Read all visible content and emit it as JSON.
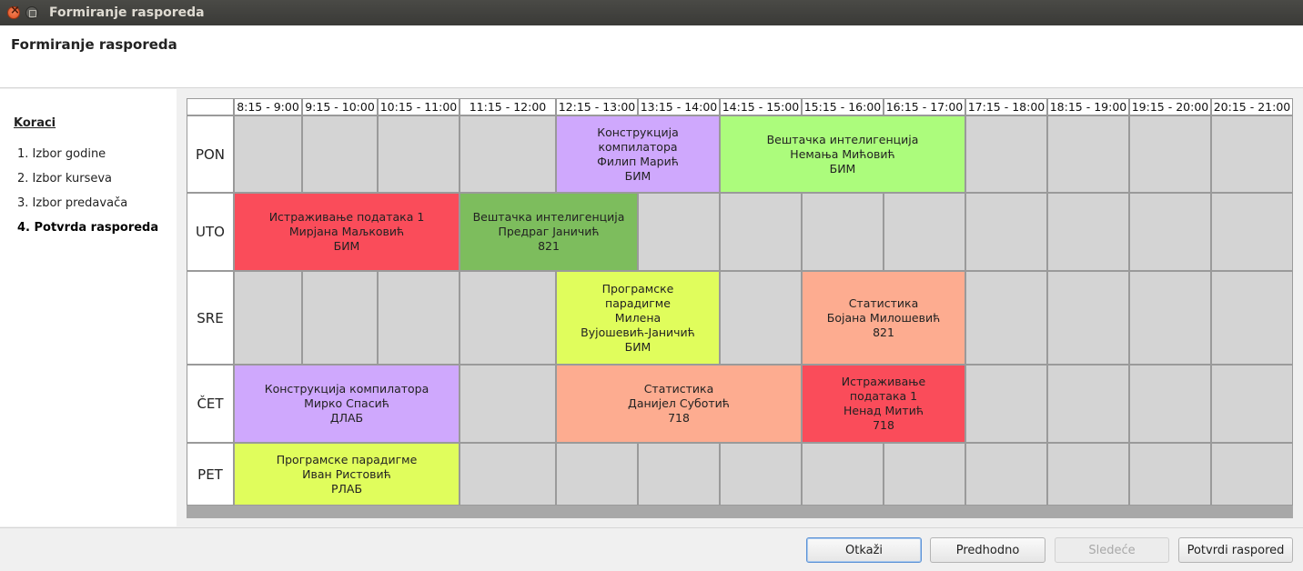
{
  "window": {
    "title": "Formiranje rasporeda"
  },
  "header": {
    "title": "Formiranje rasporeda"
  },
  "steps": {
    "title": "Koraci",
    "items": [
      {
        "label": "1. Izbor godine",
        "active": false
      },
      {
        "label": "2. Izbor kurseva",
        "active": false
      },
      {
        "label": "3. Izbor predavača",
        "active": false
      },
      {
        "label": "4. Potvrda rasporeda",
        "active": true
      }
    ]
  },
  "schedule": {
    "time_slots": [
      "8:15 - 9:00",
      "9:15 - 10:00",
      "10:15 - 11:00",
      "11:15 - 12:00",
      "12:15 - 13:00",
      "13:15 - 14:00",
      "14:15 - 15:00",
      "15:15 - 16:00",
      "16:15 - 17:00",
      "17:15 - 18:00",
      "18:15 - 19:00",
      "19:15 - 20:00",
      "20:15 - 21:00"
    ],
    "days": [
      "PON",
      "UTO",
      "SRE",
      "ČET",
      "PET"
    ],
    "classes": [
      {
        "day": 0,
        "start": 4,
        "span": 2,
        "color": "#cfa8fd",
        "lines": [
          "Конструкција",
          "компилатора",
          "Филип Марић",
          "БИМ"
        ]
      },
      {
        "day": 0,
        "start": 6,
        "span": 3,
        "color": "#acfc7c",
        "lines": [
          "Вештачка интелигенција",
          "Немања Мићовић",
          "БИМ"
        ]
      },
      {
        "day": 1,
        "start": 0,
        "span": 3,
        "color": "#fa4c5a",
        "lines": [
          "Истраживање података 1",
          "Мирјана Маљковић",
          "БИМ"
        ]
      },
      {
        "day": 1,
        "start": 3,
        "span": 2,
        "color": "#7dbd5d",
        "lines": [
          "Вештачка интелигенција",
          "Предраг Јаничић",
          "821"
        ]
      },
      {
        "day": 2,
        "start": 4,
        "span": 2,
        "color": "#e0fd5c",
        "lines": [
          "Програмске",
          "парадигме",
          "Милена",
          "Вујошевић-Јаничић",
          "БИМ"
        ]
      },
      {
        "day": 2,
        "start": 7,
        "span": 2,
        "color": "#fdac90",
        "lines": [
          "Статистика",
          "Бојана Милошевић",
          "821"
        ]
      },
      {
        "day": 3,
        "start": 0,
        "span": 3,
        "color": "#cfa8fd",
        "lines": [
          "Конструкција компилатора",
          "Мирко Спасић",
          "ДЛАБ"
        ]
      },
      {
        "day": 3,
        "start": 4,
        "span": 3,
        "color": "#fdac90",
        "lines": [
          "Статистика",
          "Данијел Суботић",
          "718"
        ]
      },
      {
        "day": 3,
        "start": 7,
        "span": 2,
        "color": "#fa4c5a",
        "lines": [
          "Истраживање",
          "података 1",
          "Ненад Митић",
          "718"
        ]
      },
      {
        "day": 4,
        "start": 0,
        "span": 3,
        "color": "#e0fd5c",
        "lines": [
          "Програмске парадигме",
          "Иван Ристовић",
          "РЛАБ"
        ]
      }
    ]
  },
  "footer": {
    "cancel_label": "Otkaži",
    "previous_label": "Predhodno",
    "next_label": "Sledeće",
    "confirm_label": "Potvrdi raspored"
  }
}
